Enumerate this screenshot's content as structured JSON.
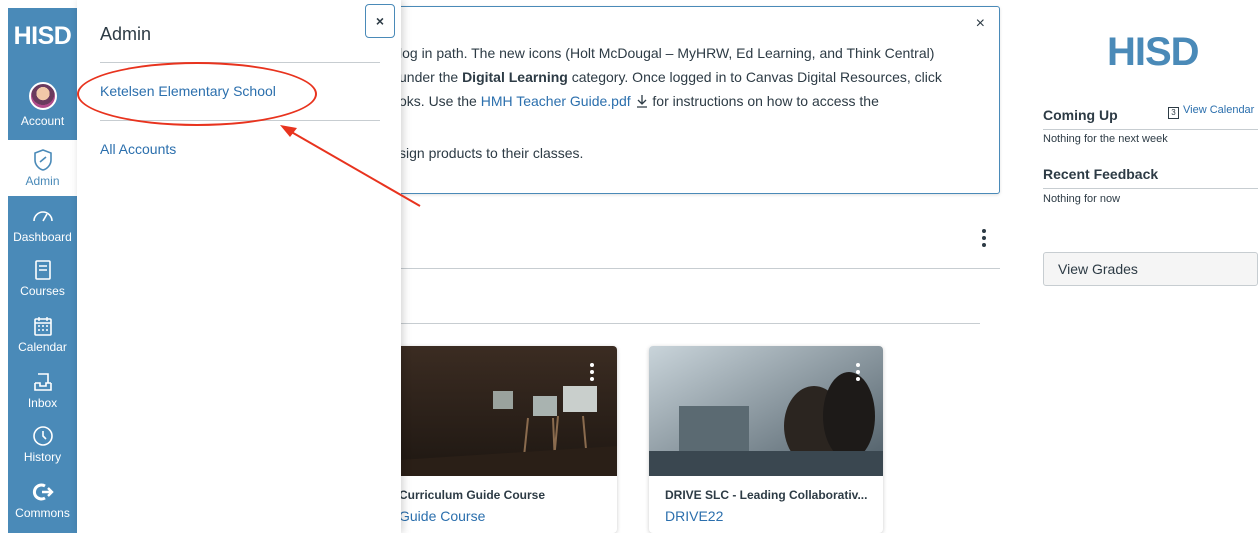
{
  "global_nav": {
    "logo": "HISD",
    "items": [
      {
        "label": "Account",
        "icon": "avatar"
      },
      {
        "label": "Admin",
        "icon": "shield-icon"
      },
      {
        "label": "Dashboard",
        "icon": "dashboard-icon"
      },
      {
        "label": "Courses",
        "icon": "book-icon"
      },
      {
        "label": "Calendar",
        "icon": "calendar-icon"
      },
      {
        "label": "Inbox",
        "icon": "inbox-icon"
      },
      {
        "label": "History",
        "icon": "clock-icon"
      },
      {
        "label": "Commons",
        "icon": "commons-icon"
      }
    ]
  },
  "tray": {
    "title": "Admin",
    "close_label": "×",
    "links": [
      "Ketelsen Elementary School",
      "All Accounts"
    ]
  },
  "notice": {
    "close_label": "×",
    "line1": "log in path. The new icons (Holt McDougal – MyHRW, Ed Learning, and Think Central)",
    "line2_pre": "under the ",
    "line2_bold": "Digital Learning",
    "line2_post": " category. Once logged in to Canvas Digital Resources, click",
    "line3_pre": "oks. Use the ",
    "line3_link": "HMH Teacher Guide.pdf",
    "line3_post": "  for instructions on how to access the",
    "line4": "sign products to their classes."
  },
  "cards": [
    {
      "title": "Curriculum Guide Course",
      "subtitle": "Guide Course"
    },
    {
      "title": "DRIVE SLC - Leading Collaborativ...",
      "subtitle": "DRIVE22"
    }
  ],
  "sidebar": {
    "logo": "HISD",
    "coming_up": "Coming Up",
    "view_calendar": "View Calendar",
    "calendar_day": "3",
    "nothing_next_week": "Nothing for the next week",
    "recent_feedback": "Recent Feedback",
    "nothing_for_now": "Nothing for now",
    "view_grades": "View Grades"
  },
  "colors": {
    "nav": "#4a8ab8",
    "link": "#2b6fad",
    "annotation": "#e8331e"
  }
}
